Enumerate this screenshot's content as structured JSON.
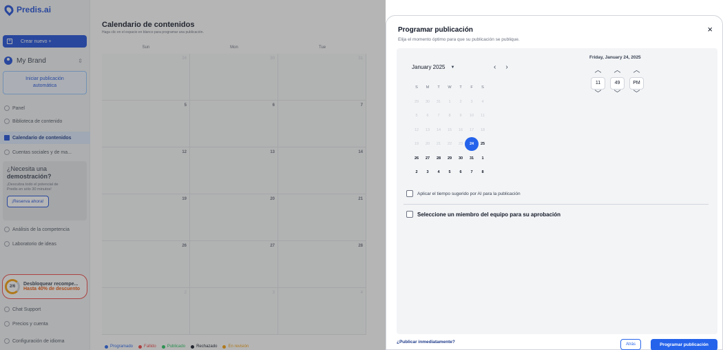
{
  "app": {
    "name": "Predis.ai"
  },
  "sidebar": {
    "create_label": "Crear nuevo +",
    "brand_name": "My Brand",
    "auto_label_1": "Iniciar publicación",
    "auto_label_2": "automática",
    "items": [
      {
        "label": "Panel"
      },
      {
        "label": "Biblioteca de contenido"
      },
      {
        "label": "Calendario de contenidos"
      },
      {
        "label": "Cuentas sociales y de ma..."
      },
      {
        "label": "Análisis de la competencia"
      },
      {
        "label": "Laboratorio de ideas"
      },
      {
        "label": "Chat Support"
      },
      {
        "label": "Precios y cuenta"
      },
      {
        "label": "Configuración de idioma"
      }
    ],
    "demo": {
      "title_1": "¿Necesita una",
      "title_2": "demostración?",
      "text_1": "¡Descubra todo el potencial de",
      "text_2": "Predis en sólo 30 minutos!",
      "button": "¡Reserva ahora!"
    },
    "unlock": {
      "progress": "2/6",
      "title": "Desbloquear recompe...",
      "subtitle": "Hasta 40% de descuento"
    }
  },
  "calendar": {
    "title": "Calendario de contenidos",
    "subtitle": "Haga clic en el espacio en blanco para programar una publicación.",
    "days": [
      "Sun",
      "Mon",
      "Tue"
    ],
    "rows": [
      [
        "24",
        "30",
        "31"
      ],
      [
        "5",
        "6",
        "7"
      ],
      [
        "12",
        "13",
        "14"
      ],
      [
        "19",
        "20",
        "21"
      ],
      [
        "26",
        "27",
        "28"
      ],
      [
        "2",
        "3",
        "4"
      ]
    ],
    "legend": [
      {
        "label": "Programado",
        "color": "#2563eb"
      },
      {
        "label": "Fallido",
        "color": "#ef4444"
      },
      {
        "label": "Publicado",
        "color": "#22c55e"
      },
      {
        "label": "Rechazado",
        "color": "#111827"
      },
      {
        "label": "En revisión",
        "color": "#f59e0b"
      }
    ]
  },
  "modal": {
    "title": "Programar publicación",
    "subtitle": "Elija el momento óptimo para que su publicación se publique.",
    "close": "×",
    "month_label": "January 2025",
    "weekdays": [
      "S",
      "M",
      "T",
      "W",
      "T",
      "F",
      "S"
    ],
    "weeks": [
      [
        "29",
        "30",
        "31",
        "1",
        "2",
        "3",
        "4"
      ],
      [
        "5",
        "6",
        "7",
        "8",
        "9",
        "10",
        "11"
      ],
      [
        "12",
        "13",
        "14",
        "15",
        "16",
        "17",
        "18"
      ],
      [
        "19",
        "20",
        "21",
        "22",
        "23",
        "24",
        "25"
      ],
      [
        "26",
        "27",
        "28",
        "29",
        "30",
        "31",
        "1"
      ],
      [
        "2",
        "3",
        "4",
        "5",
        "6",
        "7",
        "8"
      ]
    ],
    "selected_date_label": "Friday, January 24, 2025",
    "time": {
      "hour": "11",
      "minute": "49",
      "period": "PM"
    },
    "ai_checkbox_label": "Aplicar el tiempo sugerido por AI para la publicación",
    "approval_checkbox_label": "Seleccione un miembro del equipo para su aprobación",
    "publish_now_link": "¿Publicar inmediatamente?",
    "back_button": "Atrás",
    "schedule_button": "Programar publicación"
  }
}
